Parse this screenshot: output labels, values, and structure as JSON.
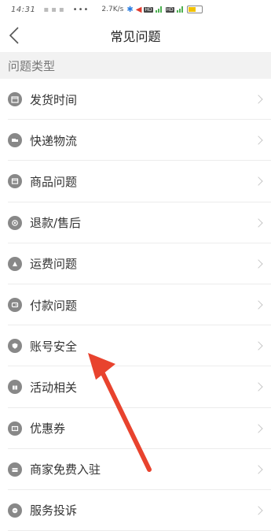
{
  "status_bar": {
    "time": "14:31",
    "speed": "2.7K/s",
    "hd_label": "HD"
  },
  "header": {
    "title": "常见问题"
  },
  "section": {
    "title": "问题类型"
  },
  "items": [
    {
      "label": "发货时间",
      "icon": "calendar-icon"
    },
    {
      "label": "快递物流",
      "icon": "truck-icon"
    },
    {
      "label": "商品问题",
      "icon": "box-icon"
    },
    {
      "label": "退款/售后",
      "icon": "refund-icon"
    },
    {
      "label": "运费问题",
      "icon": "shipping-fee-icon"
    },
    {
      "label": "付款问题",
      "icon": "wallet-icon"
    },
    {
      "label": "账号安全",
      "icon": "shield-icon"
    },
    {
      "label": "活动相关",
      "icon": "gift-icon"
    },
    {
      "label": "优惠券",
      "icon": "coupon-icon"
    },
    {
      "label": "商家免费入驻",
      "icon": "store-icon"
    },
    {
      "label": "服务投诉",
      "icon": "chat-icon"
    }
  ],
  "annotation": {
    "arrow_color": "#e8432e"
  }
}
